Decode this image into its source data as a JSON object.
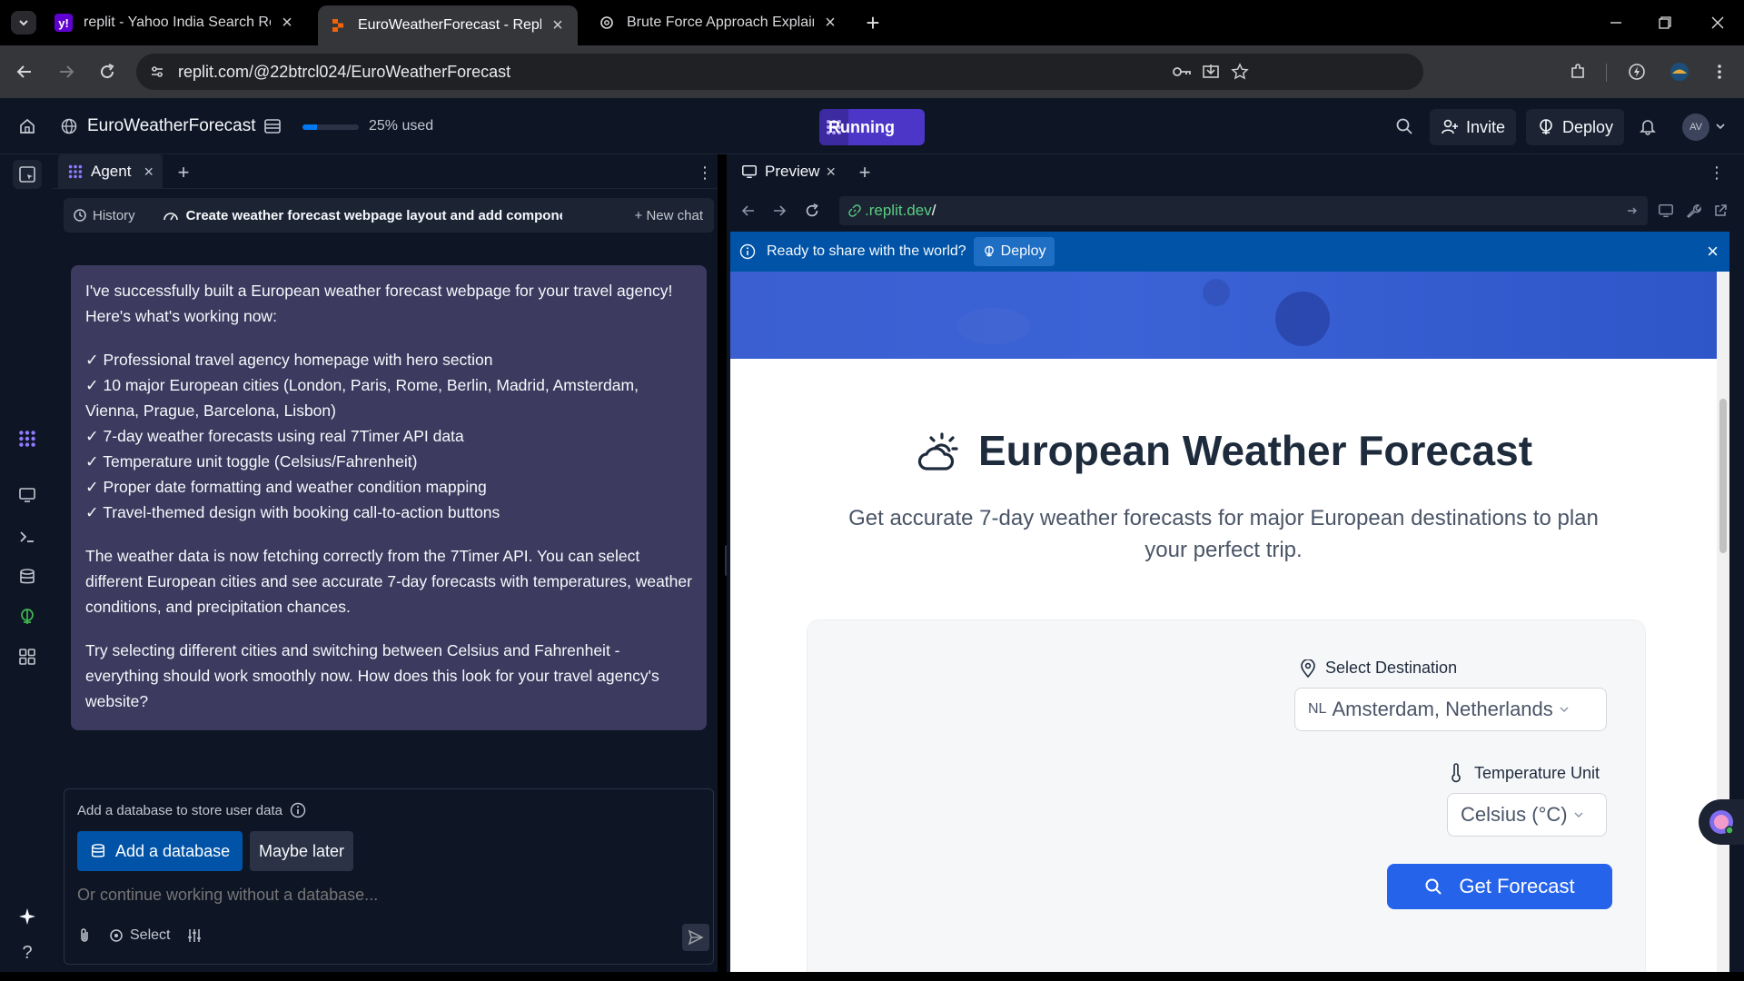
{
  "browser": {
    "tabs": [
      {
        "title": "replit - Yahoo India Search Resu",
        "favicon": "yahoo-icon"
      },
      {
        "title": "EuroWeatherForecast - Replit",
        "favicon": "replit-icon"
      },
      {
        "title": "Brute Force Approach Explained",
        "favicon": "chatgpt-icon"
      }
    ],
    "url": "replit.com/@22btrcl024/EuroWeatherForecast"
  },
  "replit_header": {
    "project_name": "EuroWeatherForecast",
    "usage_text": "25% used",
    "usage_fraction": 0.25,
    "run_label": "Running",
    "invite_label": "Invite",
    "deploy_label": "Deploy",
    "avatar_initials": "AV"
  },
  "agent": {
    "tab_label": "Agent",
    "history_label": "History",
    "chat_title": "Create weather forecast webpage layout and add components ...",
    "new_chat_label": "+ New chat",
    "message": {
      "intro": "I've successfully built a European weather forecast webpage for your travel agency! Here's what's working now:",
      "items": [
        "✓ Professional travel agency homepage with hero section",
        "✓ 10 major European cities (London, Paris, Rome, Berlin, Madrid, Amsterdam, Vienna, Prague, Barcelona, Lisbon)",
        "✓ 7-day weather forecasts using real 7Timer API data",
        "✓ Temperature unit toggle (Celsius/Fahrenheit)",
        "✓ Proper date formatting and weather condition mapping",
        "✓ Travel-themed design with booking call-to-action buttons"
      ],
      "para2": "The weather data is now fetching correctly from the 7Timer API. You can select different European cities and see accurate 7-day forecasts with temperatures, weather conditions, and precipitation chances.",
      "para3": "Try selecting different cities and switching between Celsius and Fahrenheit - everything should work smoothly now. How does this look for your travel agency's website?"
    },
    "db_prompt": {
      "heading": "Add a database to store user data",
      "add_label": "Add a database",
      "later_label": "Maybe later",
      "input_placeholder": "Or continue working without a database...",
      "select_label": "Select"
    }
  },
  "preview": {
    "tab_label": "Preview",
    "url_domain": ".replit.dev",
    "url_path": "/",
    "banner_text": "Ready to share with the world?",
    "banner_deploy": "Deploy",
    "site": {
      "title": "European Weather Forecast",
      "subtitle": "Get accurate 7-day weather forecasts for major European destinations to plan your perfect trip.",
      "destination_label": "Select Destination",
      "destination_code": "NL",
      "destination_value": "Amsterdam, Netherlands",
      "unit_label": "Temperature Unit",
      "unit_value": "Celsius (°C)",
      "button_label": "Get Forecast"
    }
  },
  "colors": {
    "replit_bg": "#0e1525",
    "agent_bubble": "#3c3a5e",
    "running_purple": "#4c36c8",
    "banner_blue": "#0053a6",
    "forecast_button": "#2563eb"
  }
}
